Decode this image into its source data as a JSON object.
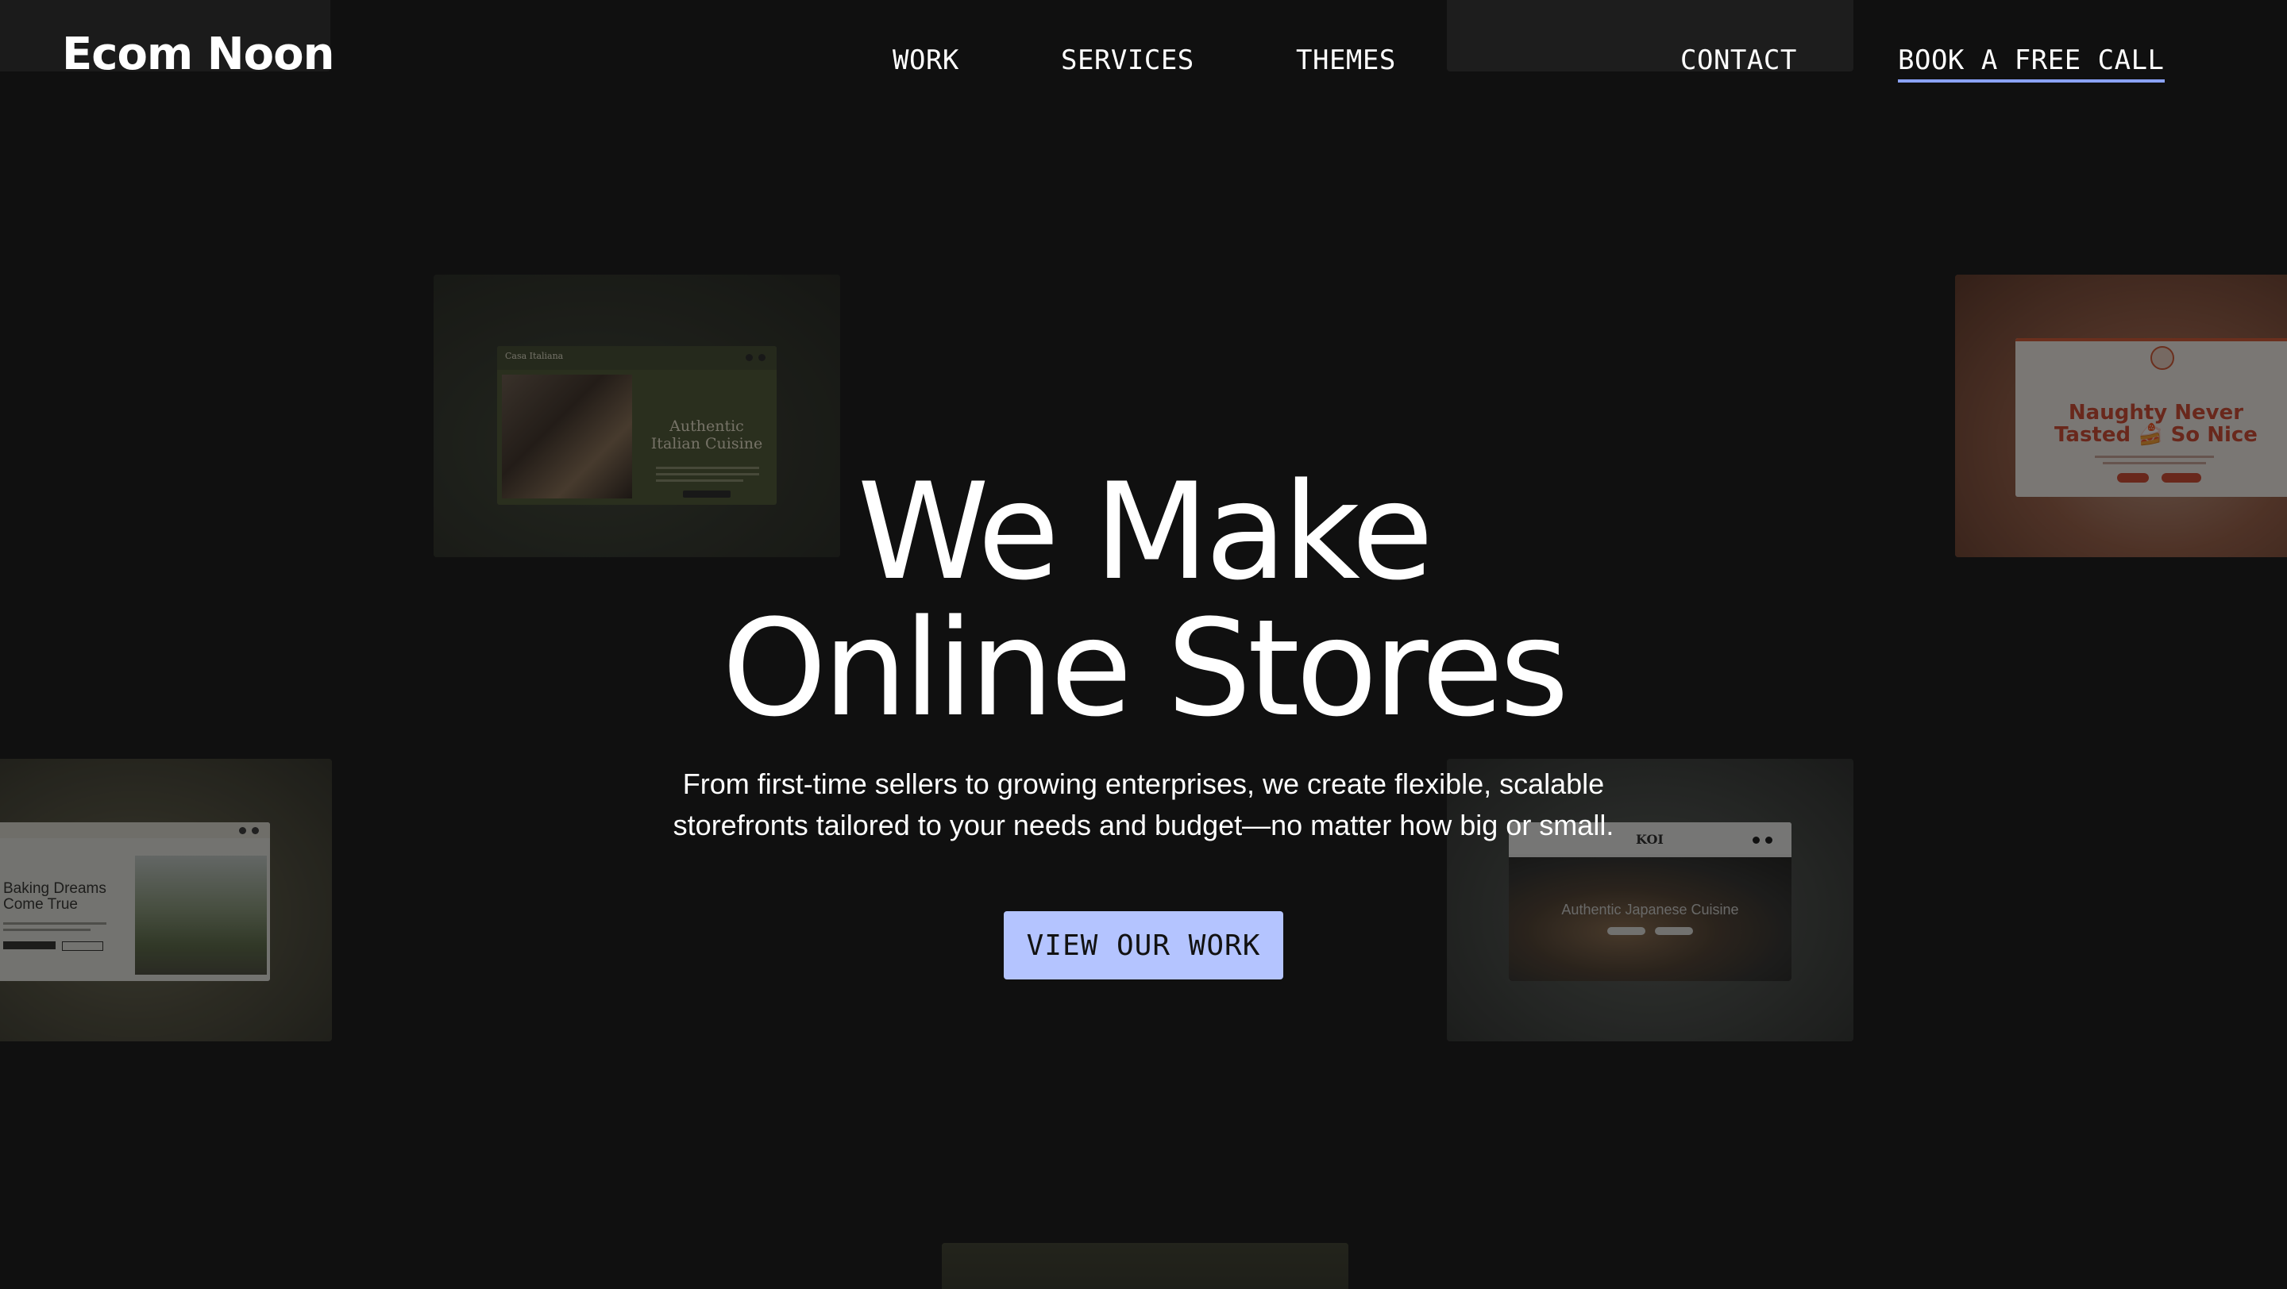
{
  "brand": {
    "logo": "Ecom Noon"
  },
  "nav": {
    "work": "WORK",
    "services": "SERVICES",
    "themes": "THEMES",
    "contact": "CONTACT",
    "book_call": "BOOK A FREE CALL"
  },
  "hero": {
    "title_line1": "We Make",
    "title_line2": "Online Stores",
    "subtitle_line1": "From first-time sellers to growing enterprises, we create flexible, scalable",
    "subtitle_line2": "storefronts tailored to your needs and budget—no matter how big or small.",
    "cta_label": "VIEW OUR WORK"
  },
  "showcase": {
    "italian": {
      "brand": "Casa Italiana",
      "headline_line1": "Authentic",
      "headline_line2": "Italian Cuisine"
    },
    "naughty": {
      "headline_line1": "Naughty Never",
      "headline_line2": "Tasted 🍰 So Nice"
    },
    "baking": {
      "headline_line1": "Baking Dreams",
      "headline_line2": "Come True"
    },
    "japanese": {
      "brand": "KOI",
      "headline": "Authentic Japanese Cuisine"
    }
  },
  "colors": {
    "background": "#101010",
    "accent": "#b4c4ff",
    "underline": "#8aa2ff"
  }
}
